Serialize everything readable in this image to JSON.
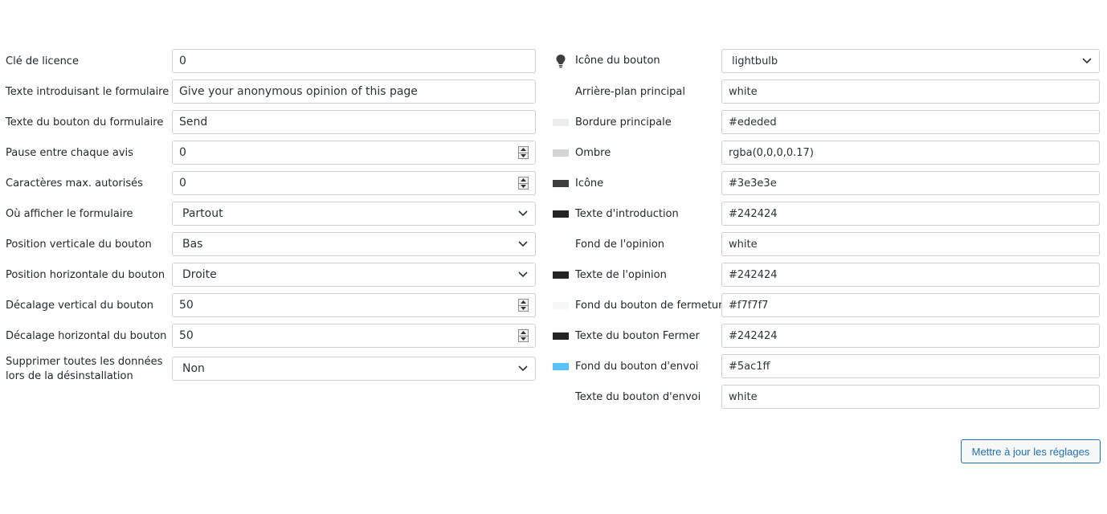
{
  "left": {
    "rows": [
      {
        "label": "Clé de licence",
        "value": "0",
        "kind": "text"
      },
      {
        "label": "Texte introduisant le formulaire",
        "value": "Give your anonymous opinion of this page",
        "kind": "text"
      },
      {
        "label": "Texte du bouton du formulaire",
        "value": "Send",
        "kind": "text"
      },
      {
        "label": "Pause entre chaque avis",
        "value": "0",
        "kind": "number"
      },
      {
        "label": "Caractères max. autorisés",
        "value": "0",
        "kind": "number"
      },
      {
        "label": "Où afficher le formulaire",
        "value": "Partout",
        "kind": "select"
      },
      {
        "label": "Position verticale du bouton",
        "value": "Bas",
        "kind": "select"
      },
      {
        "label": "Position horizontale du bouton",
        "value": "Droite",
        "kind": "select"
      },
      {
        "label": "Décalage vertical du bouton",
        "value": "50",
        "kind": "number"
      },
      {
        "label": "Décalage horizontal du bouton",
        "value": "50",
        "kind": "number"
      },
      {
        "label": "Supprimer toutes les données lors de la désinstallation",
        "value": "Non",
        "kind": "select"
      }
    ]
  },
  "right": {
    "rows": [
      {
        "label": "Icône du bouton",
        "value": "lightbulb",
        "kind": "select",
        "marker": "lightbulb-icon",
        "swatch": ""
      },
      {
        "label": "Arrière-plan principal",
        "value": "white",
        "kind": "text",
        "swatch": ""
      },
      {
        "label": "Bordure principale",
        "value": "#ededed",
        "kind": "text",
        "swatch": "#ededed"
      },
      {
        "label": "Ombre",
        "value": "rgba(0,0,0,0.17)",
        "kind": "text",
        "swatch": "#d4d4d4"
      },
      {
        "label": "Icône",
        "value": "#3e3e3e",
        "kind": "text",
        "swatch": "#3e3e3e"
      },
      {
        "label": "Texte d'introduction",
        "value": "#242424",
        "kind": "text",
        "swatch": "#242424"
      },
      {
        "label": "Fond de l'opinion",
        "value": "white",
        "kind": "text",
        "swatch": ""
      },
      {
        "label": "Texte de l'opinion",
        "value": "#242424",
        "kind": "text",
        "swatch": "#242424"
      },
      {
        "label": "Fond du bouton de fermeture",
        "value": "#f7f7f7",
        "kind": "text",
        "swatch": "#f7f7f7"
      },
      {
        "label": "Texte du bouton Fermer",
        "value": "#242424",
        "kind": "text",
        "swatch": "#242424"
      },
      {
        "label": "Fond du bouton d'envoi",
        "value": "#5ac1ff",
        "kind": "text",
        "swatch": "#5ac1ff"
      },
      {
        "label": "Texte du bouton d'envoi",
        "value": "white",
        "kind": "text",
        "swatch": ""
      }
    ]
  },
  "submit_label": "Mettre à jour les réglages",
  "colors": {
    "accent": "#2271b1"
  }
}
